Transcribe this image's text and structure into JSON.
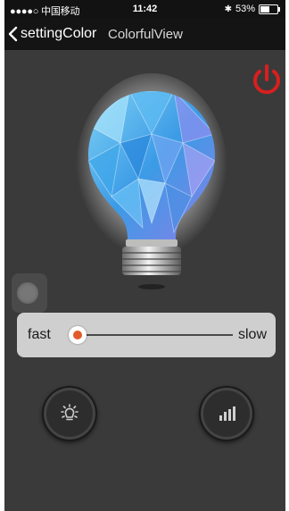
{
  "status_bar": {
    "carrier": "●●●●○ 中国移动",
    "time": "11:42",
    "battery": "53%",
    "battery_level": 0.53
  },
  "nav": {
    "back_label": "settingColor",
    "title": "ColorfulView"
  },
  "speed": {
    "fast_label": "fast",
    "slow_label": "slow",
    "value": 0.0
  },
  "colors": {
    "power": "#d81f1f",
    "knob_center": "#e35a2a",
    "panel": "#cfcfcf",
    "background": "#3a3a3a"
  },
  "icons": {
    "power": "power-icon",
    "bulb": "bulb-icon",
    "light_mode": "light-bulb-icon",
    "music_mode": "equalizer-bars-icon"
  }
}
